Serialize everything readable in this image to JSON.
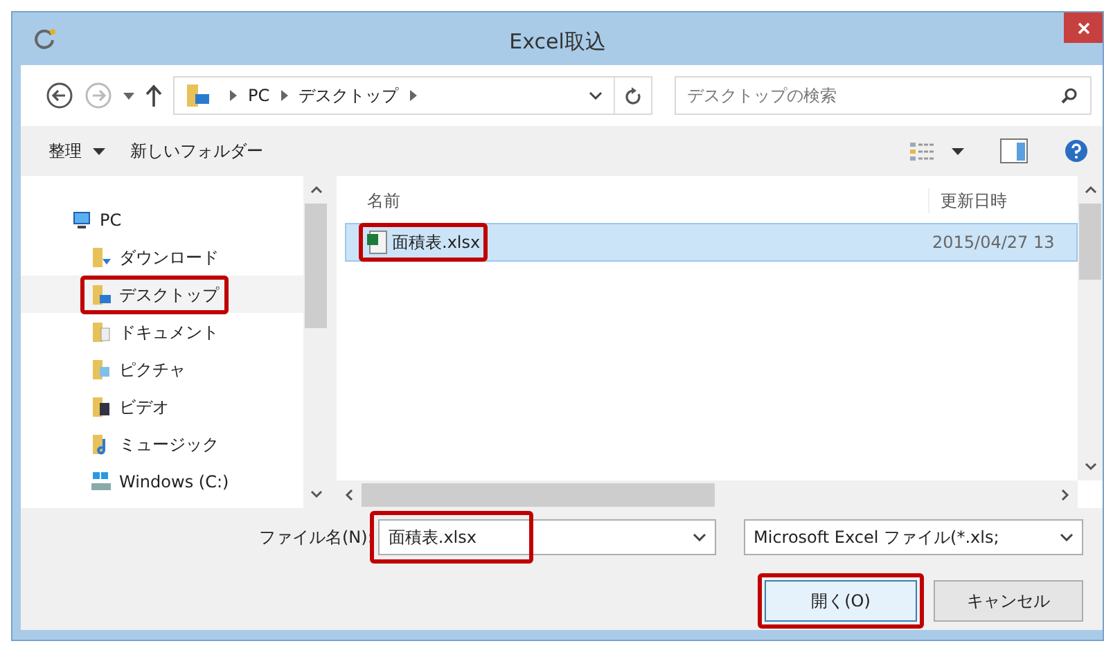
{
  "window": {
    "title": "Excel取込"
  },
  "address": {
    "crumbs": [
      "PC",
      "デスクトップ"
    ]
  },
  "search": {
    "placeholder": "デスクトップの検索"
  },
  "toolbar": {
    "buttons": [
      {
        "label": "整理",
        "dropdown": true
      },
      {
        "label": "新しいフォルダー",
        "dropdown": false
      }
    ]
  },
  "nav": {
    "items": [
      {
        "label": "PC",
        "kind": "computer",
        "selected": false,
        "highlighted": false,
        "children": [
          {
            "label": "ダウンロード",
            "kind": "download",
            "selected": false,
            "highlighted": false
          },
          {
            "label": "デスクトップ",
            "kind": "desktop",
            "selected": true,
            "highlighted": true
          },
          {
            "label": "ドキュメント",
            "kind": "documents",
            "selected": false,
            "highlighted": false
          },
          {
            "label": "ピクチャ",
            "kind": "pictures",
            "selected": false,
            "highlighted": false
          },
          {
            "label": "ビデオ",
            "kind": "videos",
            "selected": false,
            "highlighted": false
          },
          {
            "label": "ミュージック",
            "kind": "music",
            "selected": false,
            "highlighted": false
          },
          {
            "label": "Windows (C:)",
            "kind": "drive",
            "selected": false,
            "highlighted": false
          }
        ]
      }
    ]
  },
  "files": {
    "columns": [
      "名前",
      "更新日時"
    ],
    "rows": [
      {
        "name": "面積表.xlsx",
        "modified": "2015/04/27 13",
        "selected": true,
        "highlighted": true
      }
    ]
  },
  "filename": {
    "label": "ファイル名(N):",
    "value": "面積表.xlsx",
    "highlighted": true
  },
  "filter": {
    "value": "Microsoft Excel ファイル(*.xls;"
  },
  "buttons": [
    {
      "label": "開く(O)",
      "kind": "primary",
      "highlighted": true
    },
    {
      "label": "キャンセル",
      "kind": "secondary",
      "highlighted": false
    }
  ]
}
